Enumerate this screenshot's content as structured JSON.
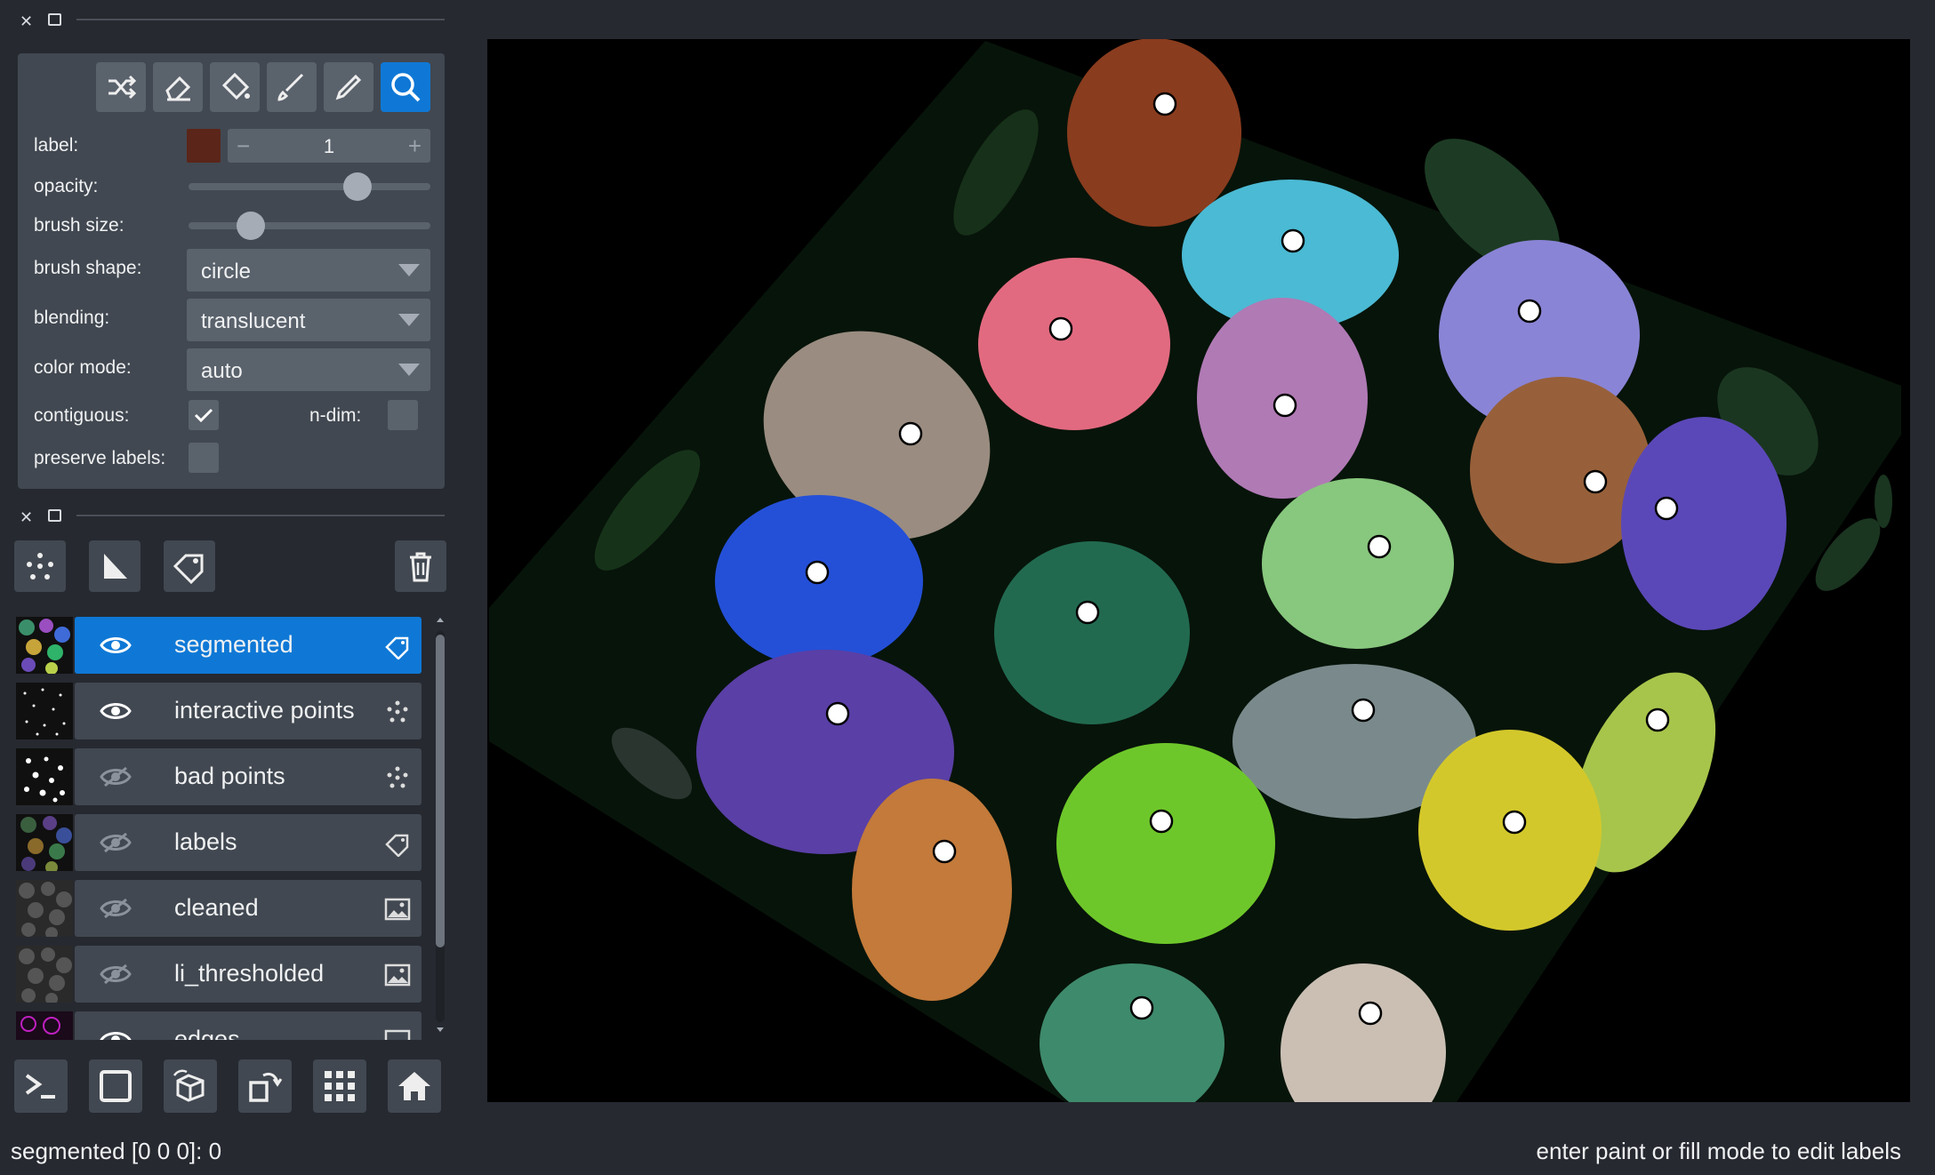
{
  "controls": {
    "tools": [
      "shuffle-colors-icon",
      "eraser-icon",
      "fill-bucket-icon",
      "paintbrush-icon",
      "color-picker-icon",
      "zoom-icon"
    ],
    "active_tool": "zoom-icon",
    "label_caption": "label:",
    "label_value": "1",
    "label_color": "#5b2519",
    "opacity_caption": "opacity:",
    "opacity_value": 0.7,
    "brush_size_caption": "brush size:",
    "brush_size_value": 0.2,
    "brush_shape_caption": "brush shape:",
    "brush_shape_value": "circle",
    "blending_caption": "blending:",
    "blending_value": "translucent",
    "color_mode_caption": "color mode:",
    "color_mode_value": "auto",
    "contiguous_caption": "contiguous:",
    "contiguous_checked": true,
    "ndim_caption": "n-dim:",
    "ndim_checked": false,
    "preserve_caption": "preserve labels:",
    "preserve_checked": false
  },
  "layer_buttons": [
    "new-points-icon",
    "new-shapes-icon",
    "new-labels-icon",
    "delete-layer-icon"
  ],
  "layers": [
    {
      "name": "segmented",
      "visible": true,
      "type": "labels",
      "selected": true
    },
    {
      "name": "interactive points",
      "visible": true,
      "type": "points",
      "selected": false
    },
    {
      "name": "bad points",
      "visible": false,
      "type": "points",
      "selected": false
    },
    {
      "name": "labels",
      "visible": false,
      "type": "labels",
      "selected": false
    },
    {
      "name": "cleaned",
      "visible": false,
      "type": "image",
      "selected": false
    },
    {
      "name": "li_thresholded",
      "visible": false,
      "type": "image",
      "selected": false
    },
    {
      "name": "edges",
      "visible": true,
      "type": "image",
      "selected": false
    }
  ],
  "bottom_buttons": [
    "console-icon",
    "2d-3d-toggle-icon",
    "roll-dims-icon",
    "transpose-icon",
    "grid-icon",
    "home-icon"
  ],
  "status": {
    "left": "segmented [0 0 0]: 0",
    "right": "enter paint or fill mode to edit labels"
  },
  "colors": {
    "background": "#262930",
    "panel": "#414851",
    "accent": "#0f78d6"
  }
}
